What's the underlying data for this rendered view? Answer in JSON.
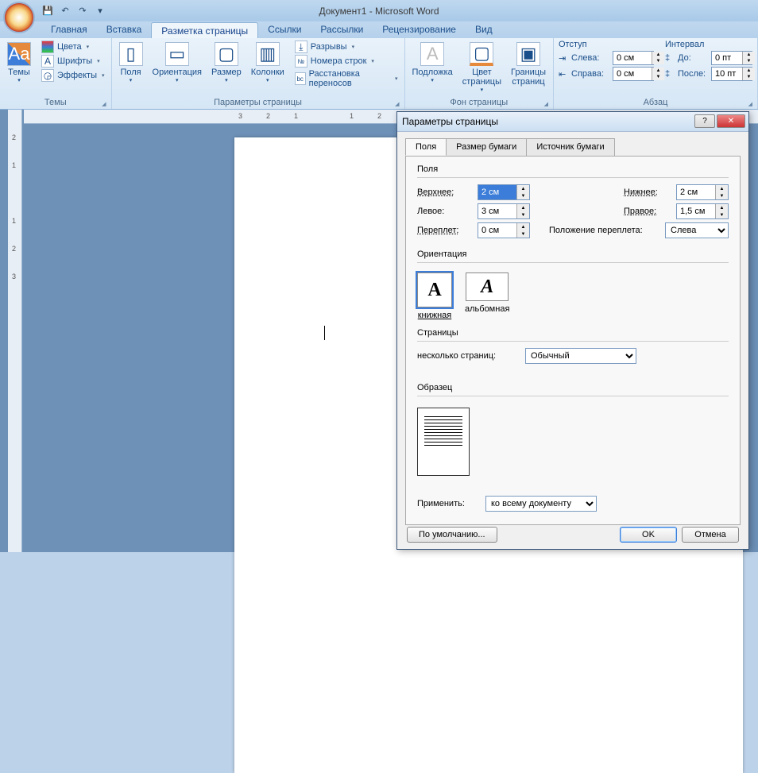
{
  "window_title": "Документ1 - Microsoft Word",
  "qat": {
    "save": "💾",
    "undo": "↶",
    "redo": "↷"
  },
  "tabs": {
    "home": "Главная",
    "insert": "Вставка",
    "page_layout": "Разметка страницы",
    "references": "Ссылки",
    "mailings": "Рассылки",
    "review": "Рецензирование",
    "view": "Вид"
  },
  "ribbon": {
    "themes_group": "Темы",
    "themes": "Темы",
    "colors": "Цвета",
    "fonts": "Шрифты",
    "effects": "Эффекты",
    "page_setup_group": "Параметры страницы",
    "margins": "Поля",
    "orientation": "Ориентация",
    "size": "Размер",
    "columns": "Колонки",
    "breaks": "Разрывы",
    "line_numbers": "Номера строк",
    "hyphenation": "Расстановка переносов",
    "page_bg_group": "Фон страницы",
    "watermark": "Подложка",
    "page_color": "Цвет страницы",
    "page_borders": "Границы страниц",
    "paragraph_group": "Абзац",
    "indent": "Отступ",
    "left_indent": "Слева:",
    "right_indent": "Справа:",
    "left_indent_val": "0 см",
    "right_indent_val": "0 см",
    "spacing": "Интервал",
    "before": "До:",
    "after": "После:",
    "before_val": "0 пт",
    "after_val": "10 пт"
  },
  "dialog": {
    "title": "Параметры страницы",
    "tabs": {
      "fields": "Поля",
      "paper": "Размер бумаги",
      "source": "Источник бумаги"
    },
    "fieldset_fields": "Поля",
    "top": "Верхнее:",
    "top_val": "2 см",
    "bottom": "Нижнее:",
    "bottom_val": "2 см",
    "left": "Левое:",
    "left_val": "3 см",
    "right": "Правое:",
    "right_val": "1,5 см",
    "gutter": "Переплет:",
    "gutter_val": "0 см",
    "gutter_pos": "Положение переплета:",
    "gutter_pos_val": "Слева",
    "orientation": "Ориентация",
    "portrait": "книжная",
    "landscape": "альбомная",
    "pages": "Страницы",
    "multi_pages": "несколько страниц:",
    "multi_pages_val": "Обычный",
    "sample": "Образец",
    "apply_to": "Применить:",
    "apply_to_val": "ко всему документу",
    "default_btn": "По умолчанию...",
    "ok": "OK",
    "cancel": "Отмена"
  }
}
